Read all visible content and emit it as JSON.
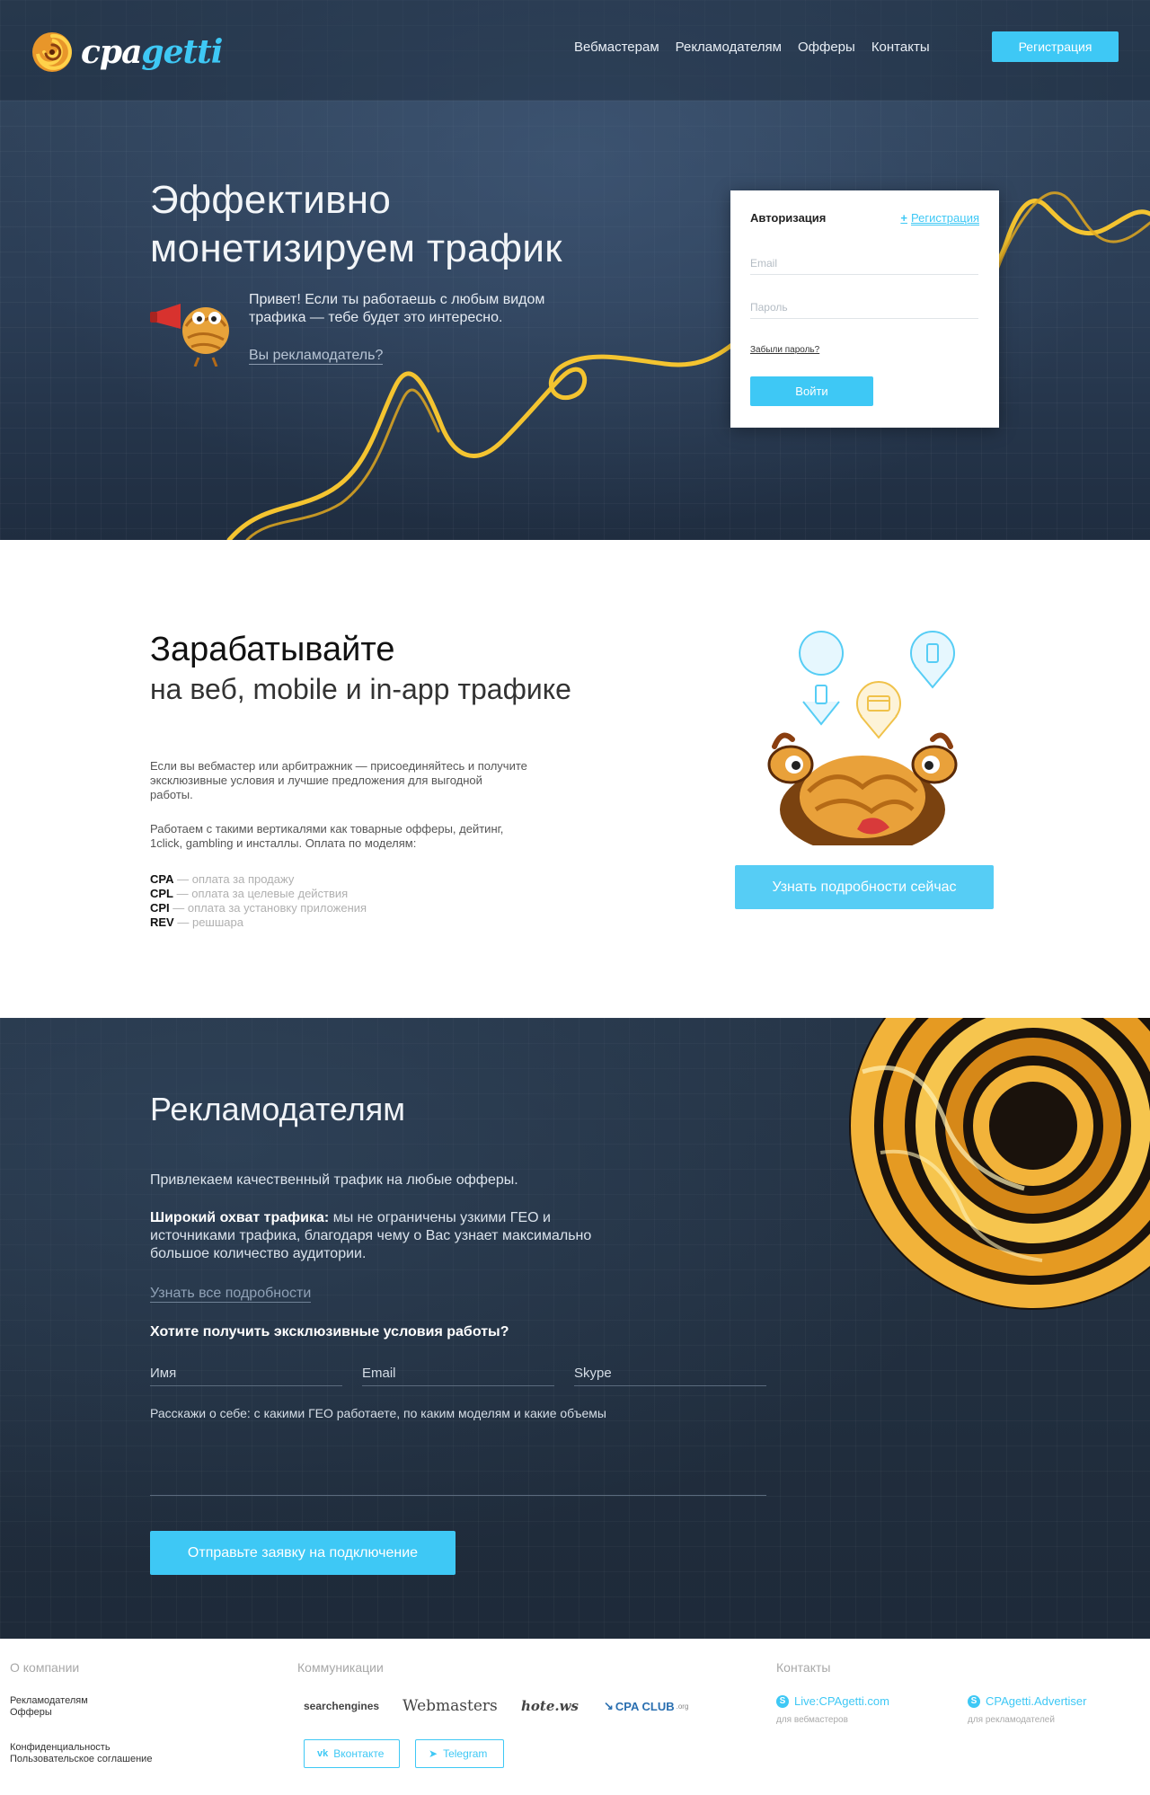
{
  "header": {
    "logo_part1": "cpa",
    "logo_part2": "getti",
    "nav": [
      "Вебмастерам",
      "Рекламодателям",
      "Офферы",
      "Контакты"
    ],
    "register_button": "Регистрация"
  },
  "hero": {
    "title_line1": "Эффективно",
    "title_line2": "монетизируем трафик",
    "text": "Привет! Если ты работаешь с любым видом трафика — тебе будет это интересно.",
    "link": "Вы рекламодатель?"
  },
  "auth": {
    "title": "Авторизация",
    "register_link": "Регистрация",
    "email_placeholder": "Email",
    "password_placeholder": "Пароль",
    "forgot": "Забыли пароль?",
    "submit": "Войти"
  },
  "earn": {
    "title": "Зарабатывайте",
    "subtitle": "на веб, mobile и in-app трафике",
    "p1": "Если вы вебмастер или арбитражник — присоединяйтесь и получите эксклюзивные условия и лучшие предложения для выгодной работы.",
    "p2": "Работаем с такими вертикалями как товарные офферы, дейтинг, 1click, gambling и инсталлы. Оплата по моделям:",
    "models": [
      {
        "code": "CPA",
        "desc": " — оплата за продажу"
      },
      {
        "code": "CPL",
        "desc": " — оплата за целевые действия"
      },
      {
        "code": "CPI",
        "desc": " — оплата за установку приложения"
      },
      {
        "code": "REV",
        "desc": " — решшара"
      }
    ],
    "cta": "Узнать подробности сейчас"
  },
  "advertisers": {
    "title": "Рекламодателям",
    "p1": "Привлекаем качественный трафик на любые офферы.",
    "p2_bold": "Широкий охват трафика:",
    "p2_rest": " мы не ограничены узкими ГЕО и источниками трафика, благодаря чему о Вас узнает максимально большое количество аудитории.",
    "link": "Узнать все подробности",
    "question": "Хотите получить эксклюзивные условия работы?",
    "name_placeholder": "Имя",
    "email_placeholder": "Email",
    "skype_placeholder": "Skype",
    "about_placeholder": "Расскажи о себе: с какими ГЕО работаете, по каким моделям и какие объемы",
    "submit": "Отправьте заявку на подключение"
  },
  "footer": {
    "about_title": "О компании",
    "about_links": [
      "Рекламодателям",
      "Офферы"
    ],
    "legal_links": [
      "Конфиденциальность",
      "Пользовательское соглашение"
    ],
    "comm_title": "Коммуникации",
    "partners": [
      "searchengines",
      "Webmasters",
      "hote.ws",
      "CPA CLUB"
    ],
    "partner_suffix": ".org",
    "social": [
      "Вконтакте",
      "Telegram"
    ],
    "contacts_title": "Контакты",
    "contacts": [
      {
        "value": "Live:CPAgetti.com",
        "note": "для вебмастеров"
      },
      {
        "value": "CPAgetti.Advertiser",
        "note": "для рекламодателей"
      }
    ]
  },
  "colors": {
    "accent": "#3ec8f5",
    "noodle": "#f4c430",
    "hero_bg": "#2e4059",
    "dark_bg": "#1f2b3a"
  }
}
